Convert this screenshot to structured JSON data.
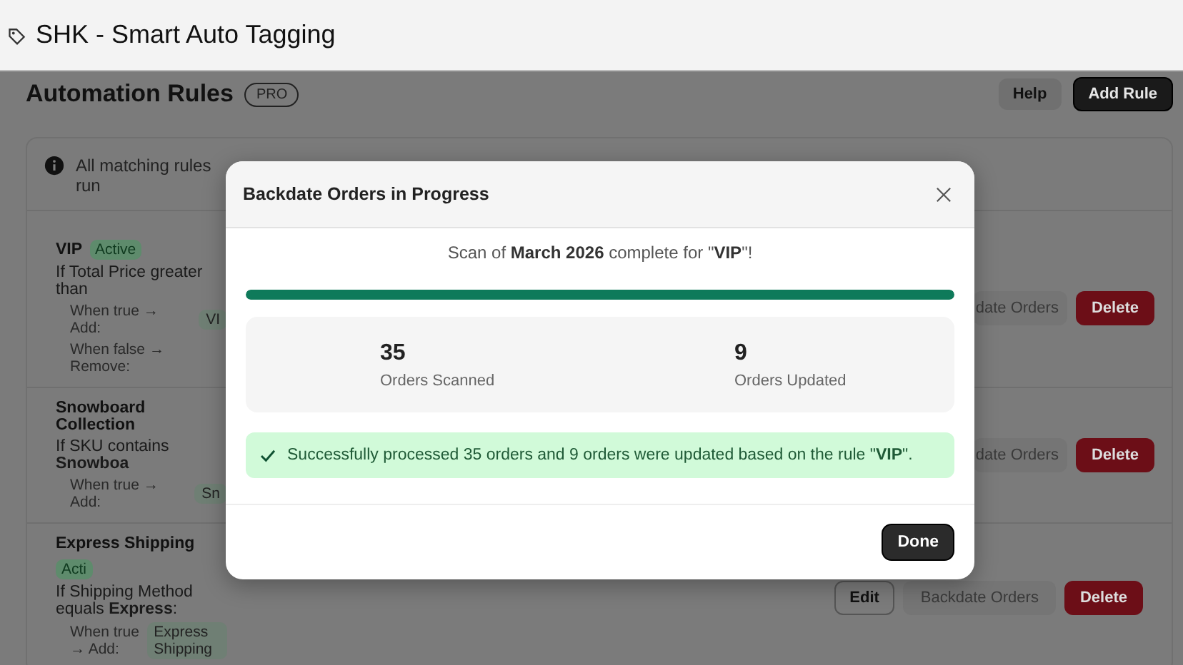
{
  "app_title": "SHK - Smart Auto Tagging",
  "page": {
    "title": "Automation Rules",
    "badge": "PRO",
    "buttons": [
      {
        "label": "Help",
        "kind": "secondary"
      },
      {
        "label": "Add Rule",
        "kind": "primary"
      }
    ]
  },
  "notice": "All matching rules run",
  "rules": [
    {
      "name": "VIP",
      "status": "Active",
      "condition": "If Total Price greater than",
      "actions": [
        {
          "label": "When true → Add:",
          "tag": "VI"
        },
        {
          "label": "When false → Remove:"
        }
      ],
      "buttons": [
        {
          "label": "date Orders",
          "kind": "ghost"
        },
        {
          "label": "Delete",
          "kind": "danger"
        }
      ]
    },
    {
      "name": "Snowboard Collection",
      "condition": "If SKU contains **Snowboa**",
      "actions": [
        {
          "label": "When true → Add:",
          "tag": "Sn"
        }
      ],
      "buttons": [
        {
          "label": "date Orders",
          "kind": "ghost"
        },
        {
          "label": "Delete",
          "kind": "danger"
        }
      ]
    },
    {
      "name": "Express Shipping",
      "status": "Acti",
      "condition": "If Shipping Method equals **Express**:",
      "actions": [
        {
          "label": "When true → Add:",
          "tag": "Express Shipping"
        }
      ],
      "buttons": [
        {
          "label": "Edit",
          "kind": "outline"
        },
        {
          "label": "Backdate Orders",
          "kind": "ghost"
        },
        {
          "label": "Delete",
          "kind": "danger"
        }
      ]
    }
  ],
  "modal": {
    "title": "Backdate Orders in Progress",
    "scan_text": "Scan of **March 2026** complete for \"**VIP**\"!",
    "progress": {
      "level": 1
    },
    "stats": [
      {
        "value": "35",
        "label": "Orders Scanned"
      },
      {
        "value": "9",
        "label": "Orders Updated"
      }
    ],
    "success": "Successfully processed 35 orders and 9 orders were updated based on the rule \"**VIP**\".",
    "button": "Done"
  }
}
